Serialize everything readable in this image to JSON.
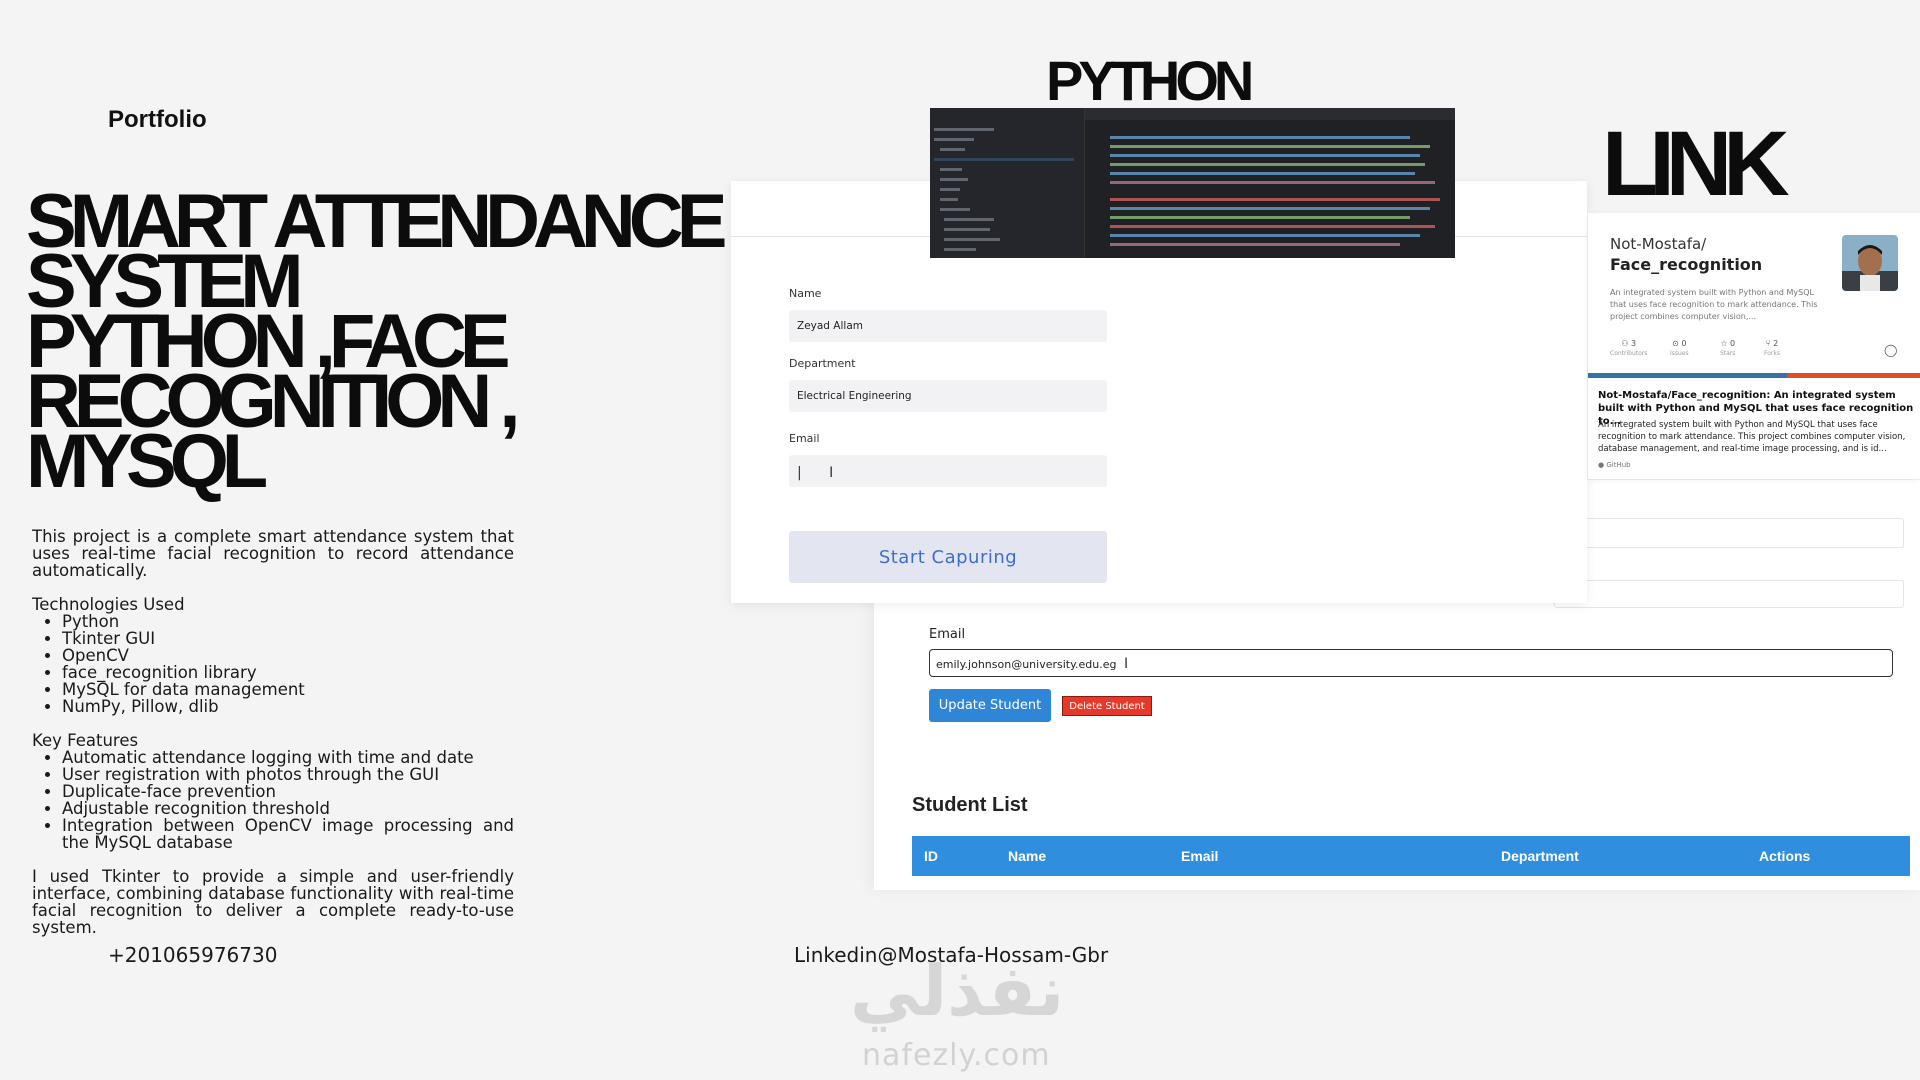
{
  "portfolio_label": "Portfolio",
  "title_lines": [
    "SMART ATTENDANCE",
    "SYSTEM",
    "PYTHON ,FACE",
    "RECOGNITION ,",
    "MYSQL"
  ],
  "intro": "This project is a complete smart attendance system that uses real-time facial recognition to record attendance automatically.",
  "technologies": {
    "heading": "Technologies Used",
    "items": [
      "Python",
      "Tkinter GUI",
      "OpenCV",
      "face_recognition library",
      "MySQL for data management",
      "NumPy, Pillow, dlib"
    ]
  },
  "features": {
    "heading": "Key Features",
    "items": [
      "Automatic attendance logging with time and date",
      "User registration with photos through the GUI",
      "Duplicate-face prevention",
      "Adjustable recognition threshold",
      "Integration between OpenCV image processing and the MySQL database"
    ]
  },
  "closing": "I used Tkinter to provide a simple and user-friendly interface, combining database functionality with real-time facial recognition to deliver a complete ready-to-use system.",
  "phone": "+201065976730",
  "linkedin": "Linkedin@Mostafa-Hossam-Gbr",
  "python_heading": "PYTHON",
  "link_heading": "LINK",
  "capture_form": {
    "name_label": "Name",
    "name_value": "Zeyad Allam",
    "department_label": "Department",
    "department_value": "Electrical Engineering",
    "email_label": "Email",
    "start_button": "Start Capuring"
  },
  "update_form": {
    "email_label": "Email",
    "email_value": "emily.johnson@university.edu.eg",
    "update_button": "Update Student",
    "delete_button": "Delete Student"
  },
  "student_list": {
    "title": "Student List",
    "columns": [
      "ID",
      "Name",
      "Email",
      "Department",
      "Actions"
    ]
  },
  "github_card": {
    "owner": "Not-Mostafa/",
    "repo": "Face_recognition",
    "description": "An integrated system built with Python and MySQL that uses face recognition to mark attendance. This project combines computer vision,...",
    "stats": [
      {
        "value": "3",
        "label": "Contributors"
      },
      {
        "value": "0",
        "label": "Issues"
      },
      {
        "value": "0",
        "label": "Stars"
      },
      {
        "value": "2",
        "label": "Forks"
      }
    ],
    "link_title": "Not-Mostafa/Face_recognition: An integrated system built with Python and MySQL that uses face recognition to...",
    "link_body": "An integrated system built with Python and MySQL that uses face recognition to mark attendance. This project combines computer vision, database management, and real-time image processing, and is id...",
    "source": "GitHub"
  },
  "watermark": {
    "arabic": "نفذلي",
    "latin": "nafezly.com"
  },
  "colors": {
    "primary_blue": "#2f86d6",
    "table_header": "#2f8fde",
    "delete_red": "#e53a2b",
    "start_button_text": "#3d6ecf"
  }
}
